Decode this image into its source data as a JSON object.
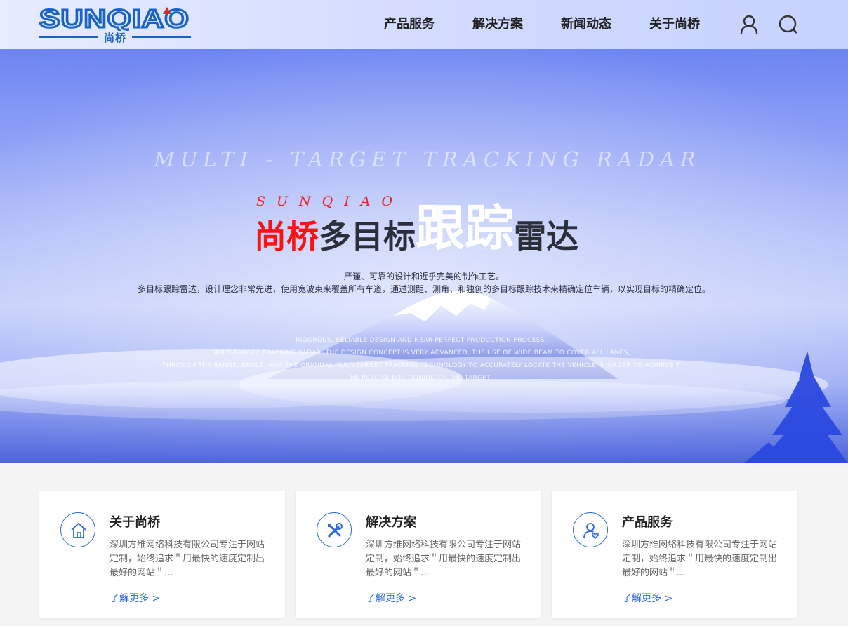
{
  "header": {
    "logo_text": "SUNQIAO",
    "logo_cn": "尚桥",
    "nav": [
      "产品服务",
      "解决方案",
      "新闻动态",
      "关于尚桥"
    ]
  },
  "banner": {
    "en_title": "MULTI - TARGET TRACKING RADAR",
    "brand_letters": "SUNQIAO",
    "cn_title_red": "尚桥",
    "cn_title_dark1": "多目标",
    "cn_title_white": "跟踪",
    "cn_title_dark2": "雷达",
    "desc_line1": "严谨、可靠的设计和近乎完美的制作工艺。",
    "desc_line2": "多目标跟踪雷达，设计理念非常先进，使用宽波束来覆盖所有车道，通过测距、测角、和独创的多目标跟踪技术来精确定位车辆，以实现目标的精确定位。",
    "en_desc": [
      "RIGOROUS, RELIABLE DESIGN AND NEAR-PERFECT PRODUCTION PROCESS.",
      "MULTI-TARGET TRACKING RADAR, THE DESIGN CONCEPT IS VERY ADVANCED, THE USE OF WIDE BEAM TO COVER ALL LANES,",
      "THROUGH THE RANGE, ANGLE, AND THE ORIGINAL MULTI-TARGET TRACKING TECHNOLOGY TO ACCURATELY LOCATE THE VEHICLE IN ORDER TO ACHIEVE T",
      "HE PRECISE POSITIONING OF THE TARGET."
    ]
  },
  "cards": [
    {
      "icon": "house-icon",
      "title": "关于尚桥",
      "text": "深圳方维网络科技有限公司专注于网站定制，始终追求＂用最快的速度定制出最好的网站＂...",
      "more": "了解更多 >"
    },
    {
      "icon": "tools-icon",
      "title": "解决方案",
      "text": "深圳方维网络科技有限公司专注于网站定制，始终追求＂用最快的速度定制出最好的网站＂...",
      "more": "了解更多 >"
    },
    {
      "icon": "user-heart-icon",
      "title": "产品服务",
      "text": "深圳方维网络科技有限公司专注于网站定制，始终追求＂用最快的速度定制出最好的网站＂...",
      "more": "了解更多 >"
    }
  ],
  "colors": {
    "accent": "#2d6be0",
    "brand_red": "#ff1111",
    "logo_blue": "#1a63c6"
  }
}
